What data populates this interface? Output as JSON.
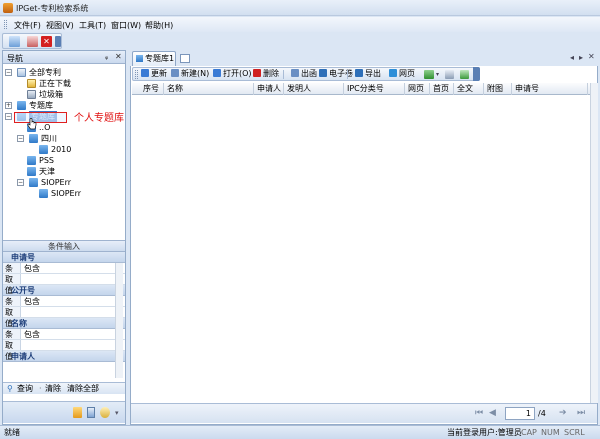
{
  "window": {
    "title": "IPGet-专利检索系统"
  },
  "menu": [
    "文件(F)",
    "视图(V)",
    "工具(T)",
    "窗口(W)",
    "帮助(H)"
  ],
  "nav_panel": {
    "title": "导航",
    "pin": "ᵩ",
    "close": "✕",
    "tree": [
      {
        "label": "全部专利",
        "level": 0,
        "expander": "−",
        "icon": "book"
      },
      {
        "label": "正在下载",
        "level": 1,
        "expander": "",
        "icon": "dl"
      },
      {
        "label": "垃圾箱",
        "level": 1,
        "expander": "",
        "icon": "trash"
      },
      {
        "label": "专题库",
        "level": 0,
        "expander": "+",
        "icon": "folder"
      },
      {
        "label": "专题库",
        "level": 0,
        "expander": "−",
        "icon": "folder",
        "selected": true
      },
      {
        "label": "..O",
        "level": 1,
        "expander": "",
        "icon": "folder"
      },
      {
        "label": "四川",
        "level": 1,
        "expander": "−",
        "icon": "folder"
      },
      {
        "label": "2010",
        "level": 2,
        "expander": "",
        "icon": "folder"
      },
      {
        "label": "PSS",
        "level": 1,
        "expander": "",
        "icon": "folder"
      },
      {
        "label": "天津",
        "level": 1,
        "expander": "",
        "icon": "folder"
      },
      {
        "label": "SIOPErr",
        "level": 1,
        "expander": "−",
        "icon": "folder"
      },
      {
        "label": "SIOPErr",
        "level": 2,
        "expander": "",
        "icon": "folder"
      }
    ]
  },
  "annotation": {
    "text": "个人专题库"
  },
  "condition_panel": {
    "title": "条件输入",
    "groups": [
      {
        "name": "申请号",
        "rows": [
          {
            "k": "条件",
            "v": "包含"
          },
          {
            "k": "取值",
            "v": ""
          }
        ]
      },
      {
        "name": "公开号",
        "rows": [
          {
            "k": "条件",
            "v": "包含"
          },
          {
            "k": "取值",
            "v": ""
          }
        ]
      },
      {
        "name": "名称",
        "rows": [
          {
            "k": "条件",
            "v": "包含"
          },
          {
            "k": "取值",
            "v": ""
          }
        ]
      },
      {
        "name": "申请人",
        "rows": []
      }
    ],
    "buttons": {
      "query": "查询",
      "clear": "清除",
      "clear_all": "清除全部"
    }
  },
  "main": {
    "tab_label": "专题库1",
    "toolbar": [
      {
        "label": "更新",
        "icon": "refresh-icon",
        "color": "#3a7bd5"
      },
      {
        "label": "新建(N)",
        "icon": "new-icon",
        "color": "#6a8fc4"
      },
      {
        "label": "打开(O)",
        "icon": "open-icon",
        "color": "#3a7bd5"
      },
      {
        "label": "删除",
        "icon": "delete-icon",
        "color": "#d02020"
      },
      {
        "label": "出函",
        "icon": "letter-icon",
        "color": "#6a8fc4"
      },
      {
        "label": "电子卷",
        "icon": "volume-icon",
        "color": "#2e6fb8"
      },
      {
        "label": "导出",
        "icon": "export-icon",
        "color": "#2e6fb8"
      },
      {
        "label": "网页",
        "icon": "web-icon",
        "color": "#2e8fd8"
      }
    ],
    "columns": [
      "序号",
      "名称",
      "申请人",
      "发明人",
      "IPC分类号",
      "网页",
      "首页",
      "全文",
      "附图",
      "申请号"
    ],
    "pager": {
      "current": "1",
      "total": "/4"
    }
  },
  "status": {
    "left": "就绪",
    "user": "当前登录用户:管理员",
    "caps": "CAP",
    "num": "NUM",
    "scrl": "SCRL"
  }
}
